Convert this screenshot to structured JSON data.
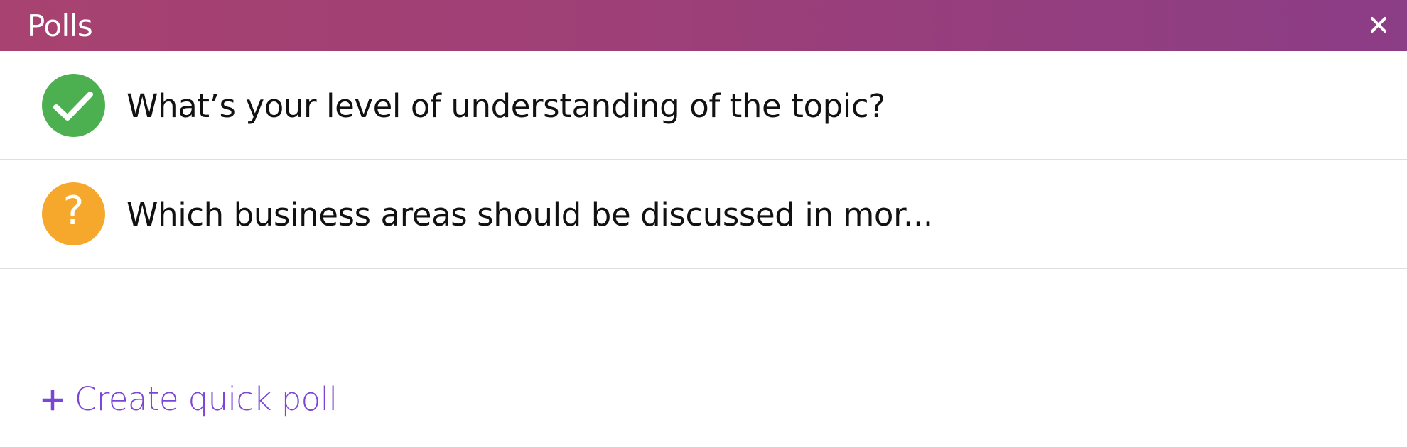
{
  "window": {
    "title": "Polls",
    "close_icon": "close-icon"
  },
  "polls": [
    {
      "question": "What’s your level of understanding of the topic?",
      "status": "answered",
      "icon": "check-circle-icon",
      "color": "#4cb050"
    },
    {
      "question": "Which business areas should be discussed in mor...",
      "status": "pending",
      "icon": "question-circle-icon",
      "symbol": "?",
      "color": "#f6a82d"
    }
  ],
  "actions": {
    "create_quick_poll": {
      "icon": "plus-icon",
      "label": "Create quick poll",
      "color": "#7b46d6"
    }
  },
  "theme": {
    "header_gradient_start": "#a84270",
    "header_gradient_end": "#8b3d86",
    "divider": "#dedede"
  }
}
